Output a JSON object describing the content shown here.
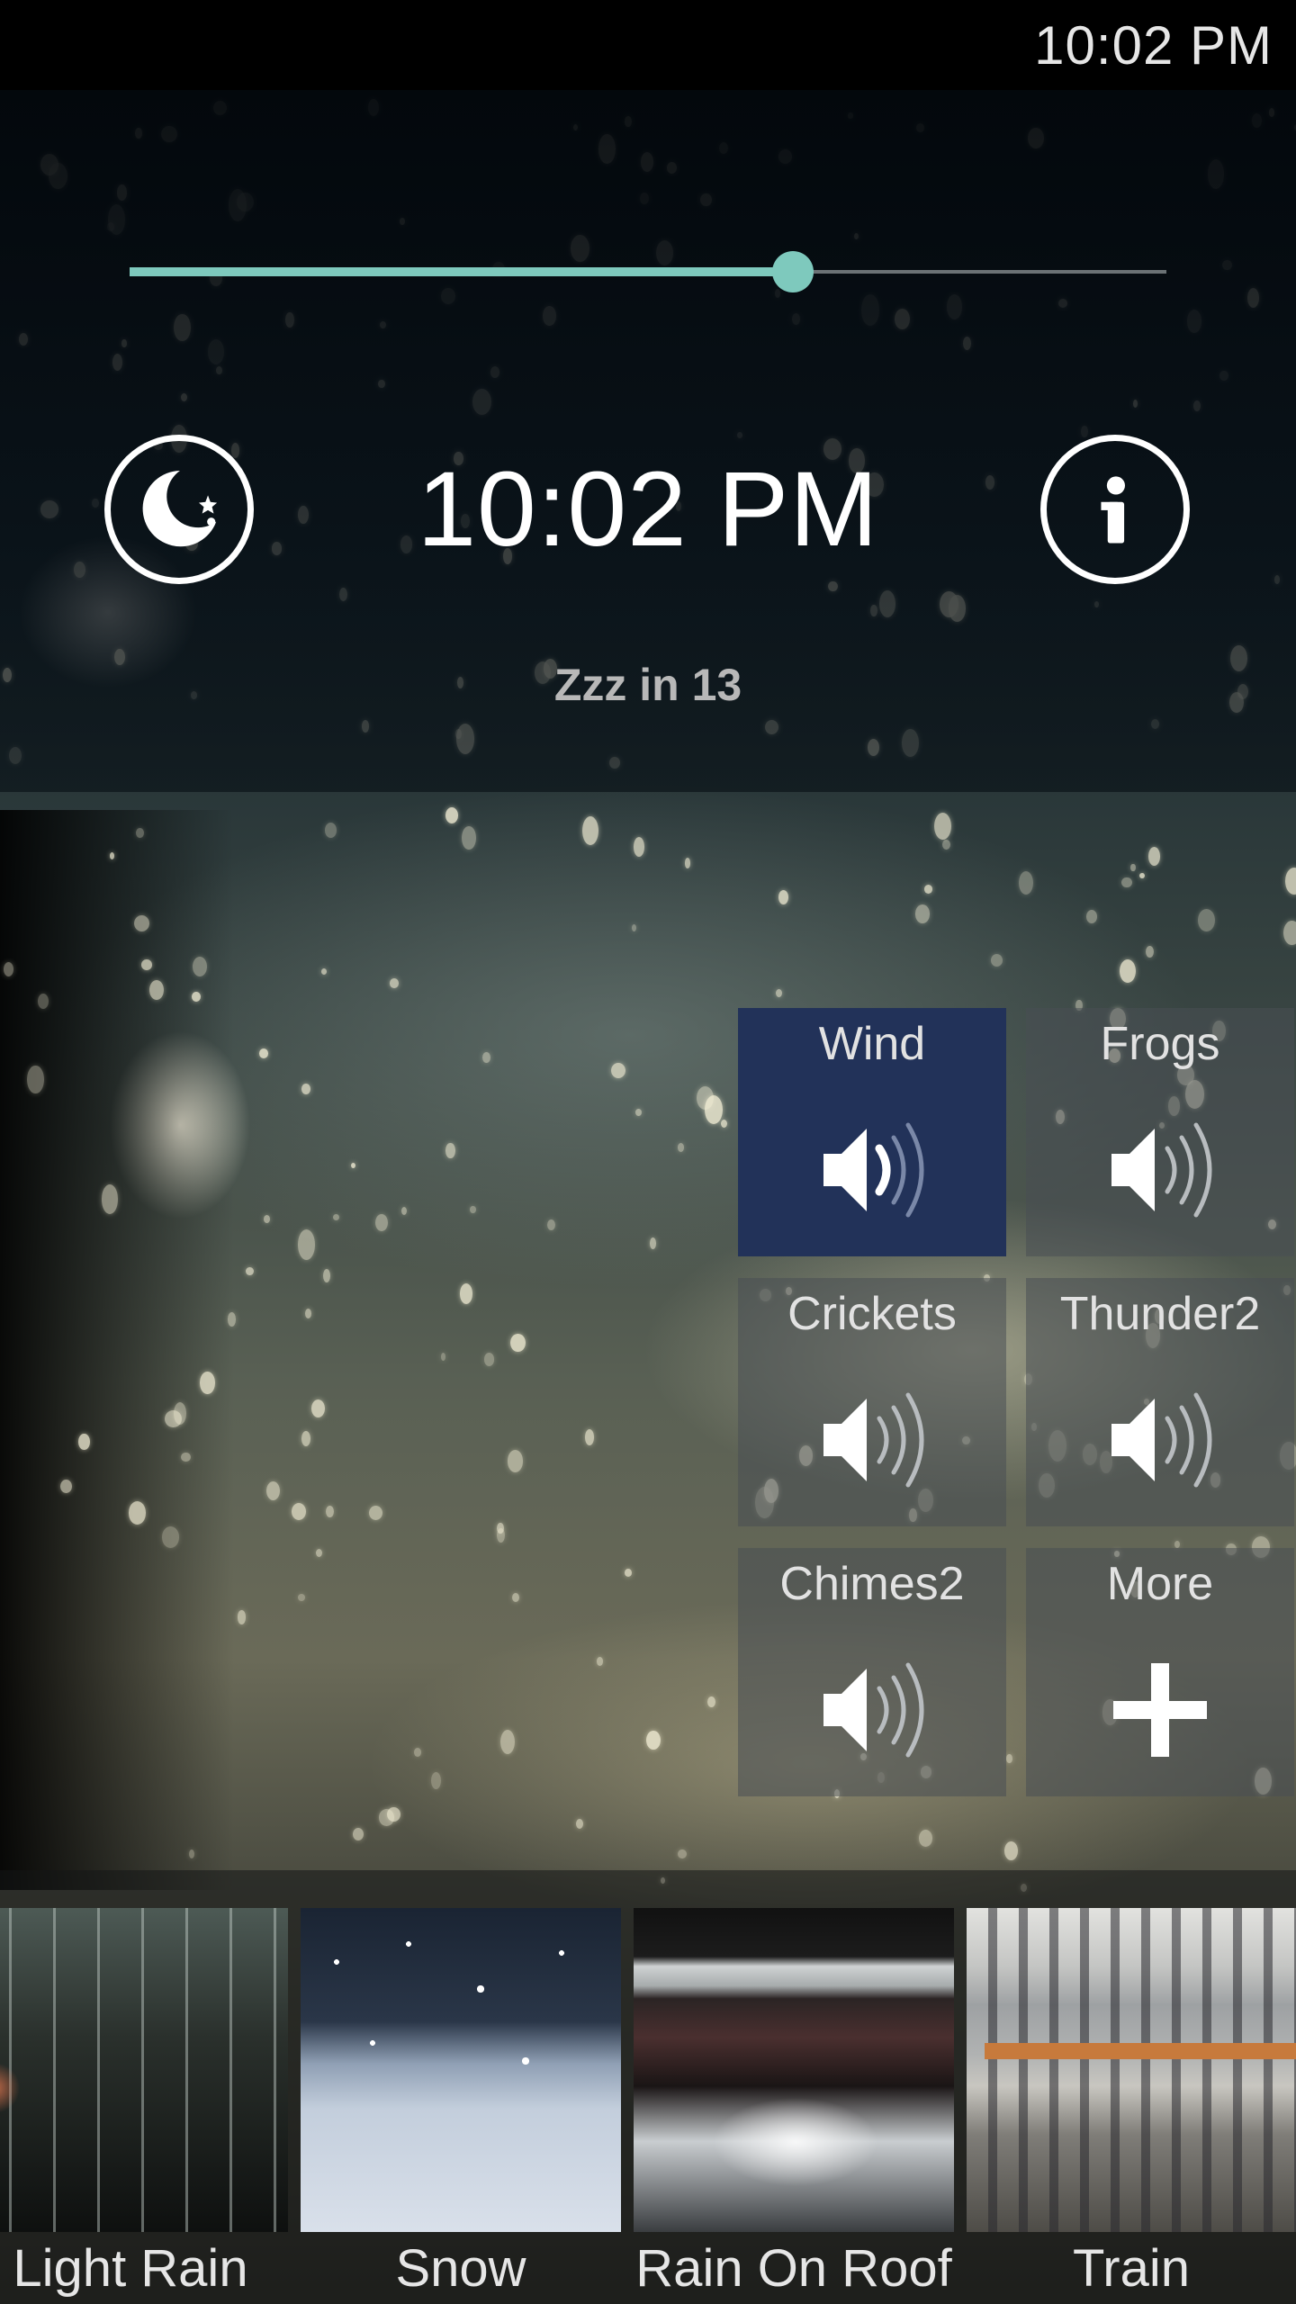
{
  "status_bar": {
    "time": "10:02 PM"
  },
  "player": {
    "volume_fraction": 0.64,
    "accent_color": "#7ec9bd",
    "time": "10:02 PM",
    "sleep_timer_text": "Zzz in 13",
    "moon_button_icon": "moon-stars-icon",
    "info_button_icon": "info-icon"
  },
  "sound_tiles": [
    {
      "label": "Wind",
      "icon": "speaker-icon",
      "active": true
    },
    {
      "label": "Frogs",
      "icon": "speaker-icon",
      "active": false
    },
    {
      "label": "Crickets",
      "icon": "speaker-icon",
      "active": false
    },
    {
      "label": "Thunder2",
      "icon": "speaker-icon",
      "active": false
    },
    {
      "label": "Chimes2",
      "icon": "speaker-icon",
      "active": false
    },
    {
      "label": "More",
      "icon": "plus-icon",
      "active": false
    }
  ],
  "scenes": [
    {
      "label": "Light Rain"
    },
    {
      "label": "Snow"
    },
    {
      "label": "Rain On Roof"
    },
    {
      "label": "Train"
    }
  ],
  "colors": {
    "active_tile": "#223259",
    "accent": "#7ec9bd"
  }
}
